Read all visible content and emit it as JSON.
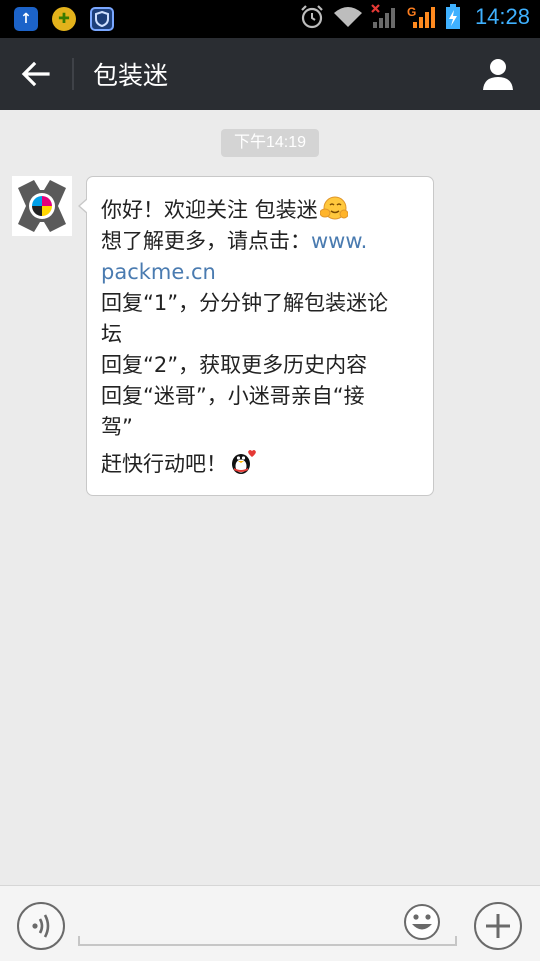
{
  "status_bar": {
    "time": "14:28",
    "icons": [
      "upload-app-icon",
      "game-app-icon",
      "shield-app-icon",
      "alarm-icon",
      "wifi-icon",
      "signal-no-sim-icon",
      "signal-g-icon",
      "battery-charging-icon"
    ],
    "network_letter": "G"
  },
  "header": {
    "title": "包装迷",
    "back_icon": "arrow-left-icon",
    "profile_icon": "person-icon"
  },
  "chat": {
    "timestamp": "下午14:19",
    "messages": [
      {
        "sender": "包装迷",
        "lines": {
          "l1": "你好！欢迎关注 包装迷",
          "l2a": "想了解更多，请点击：",
          "l2b": "www.",
          "l3": "packme.cn",
          "l4": "回复“1”，分分钟了解包装迷论",
          "l5": "坛",
          "l6": "回复“2”，获取更多历史内容",
          "l7": "回复“迷哥”，小迷哥亲自“接",
          "l8": "驾”",
          "l9": "赶快行动吧！"
        },
        "emojis": [
          "hug-emoji",
          "penguin-heart-emoji"
        ]
      }
    ]
  },
  "input_bar": {
    "placeholder": "",
    "voice_icon": "voice-icon",
    "emoji_icon": "smiley-icon",
    "plus_icon": "plus-icon"
  },
  "colors": {
    "status_time": "#3fb1ff",
    "title_bar": "#2a2d32",
    "chat_bg": "#ebebeb",
    "link": "#4a7bb0"
  }
}
